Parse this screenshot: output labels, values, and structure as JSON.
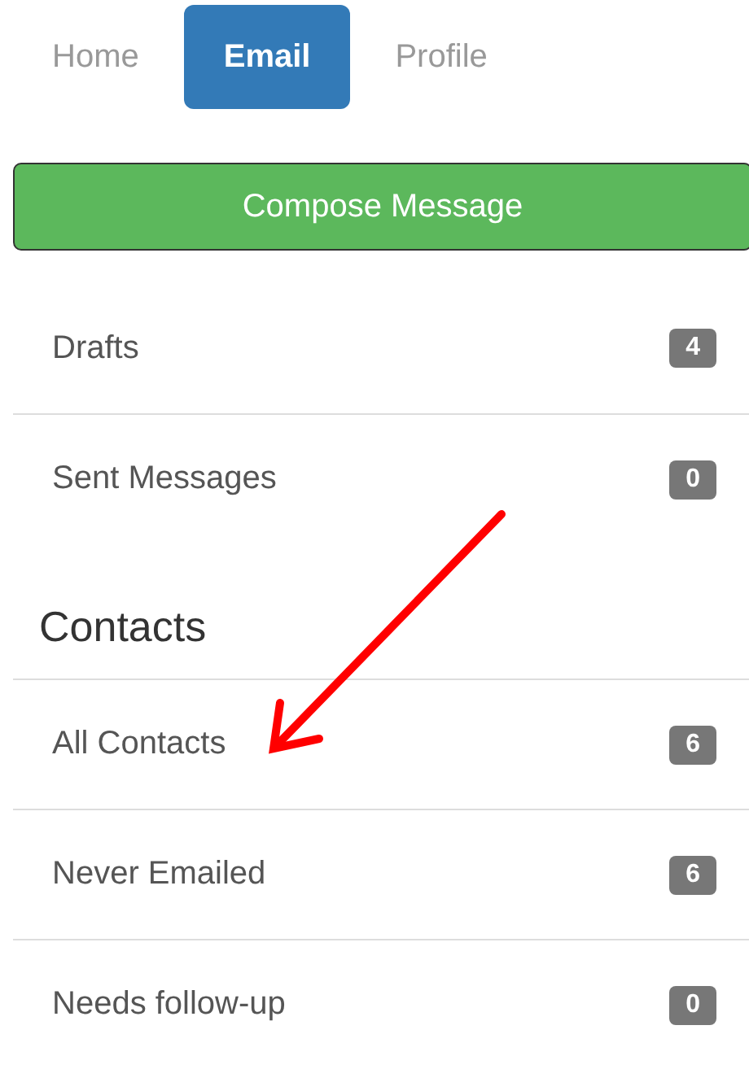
{
  "tabs": [
    {
      "label": "Home",
      "selected": false
    },
    {
      "label": "Email",
      "selected": true
    },
    {
      "label": "Profile",
      "selected": false
    }
  ],
  "compose_button": "Compose Message",
  "sections": [
    {
      "items": [
        {
          "label": "Drafts",
          "count": "4"
        },
        {
          "label": "Sent Messages",
          "count": "0"
        }
      ]
    },
    {
      "heading": "Contacts",
      "items": [
        {
          "label": "All Contacts",
          "count": "6"
        },
        {
          "label": "Never Emailed",
          "count": "6"
        },
        {
          "label": "Needs follow-up",
          "count": "0"
        }
      ]
    }
  ]
}
